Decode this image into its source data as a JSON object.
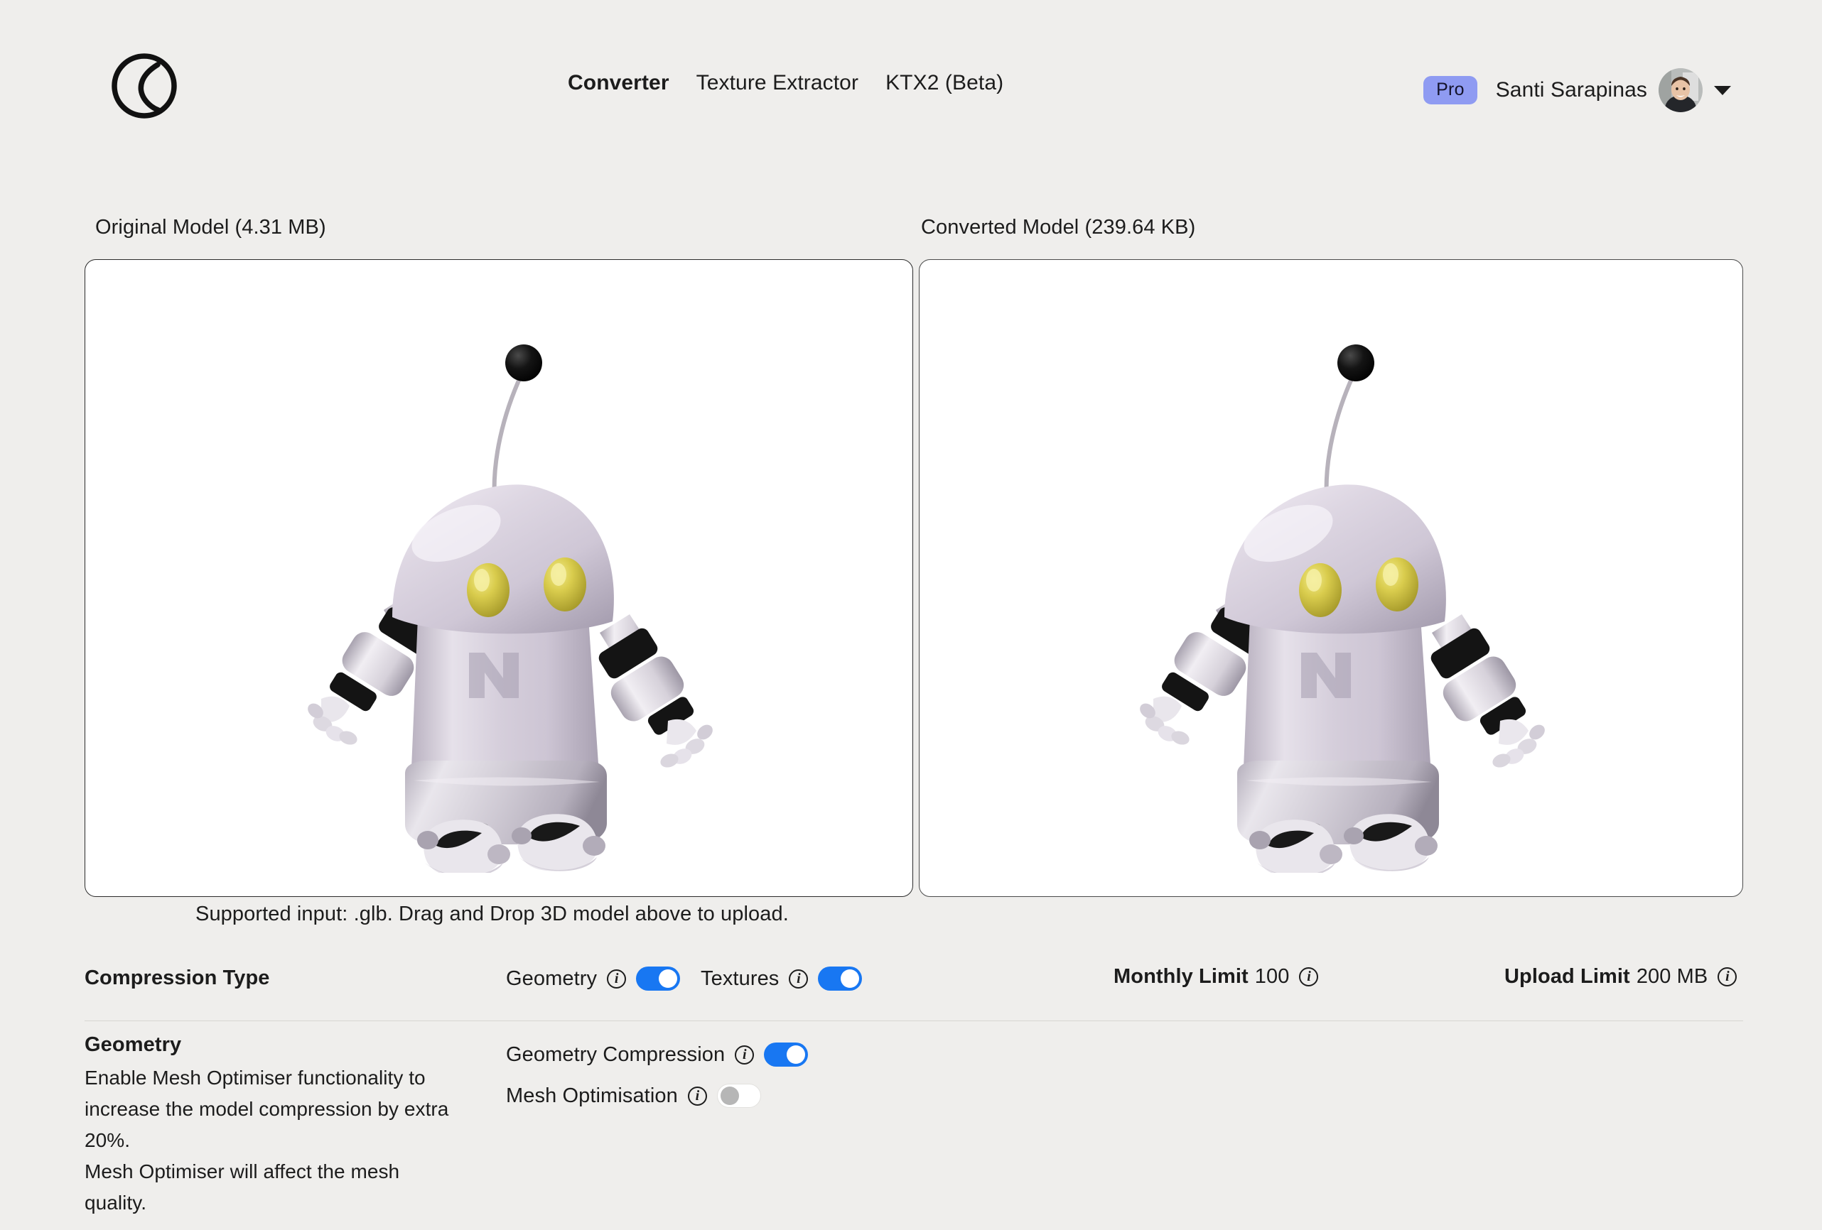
{
  "header": {
    "logo_icon": "crescent-circle-logo",
    "nav": [
      {
        "label": "Converter",
        "active": true
      },
      {
        "label": "Texture Extractor",
        "active": false
      },
      {
        "label": "KTX2 (Beta)",
        "active": false
      }
    ],
    "pro_badge": "Pro",
    "user_name": "Santi Sarapinas",
    "avatar_icon": "user-avatar-photo",
    "caret_icon": "chevron-down-icon"
  },
  "viewers": {
    "original_label": "Original Model (4.31 MB)",
    "converted_label": "Converted Model (239.64 KB)",
    "hint": "Supported input: .glb. Drag and Drop 3D model above to upload."
  },
  "compression": {
    "section_label": "Compression Type",
    "geometry_label": "Geometry",
    "geometry_on": true,
    "textures_label": "Textures",
    "textures_on": true,
    "monthly_limit_label": "Monthly Limit",
    "monthly_limit_value": "100",
    "upload_limit_label": "Upload Limit",
    "upload_limit_value": "200 MB",
    "info_icon": "info-icon"
  },
  "geometry_section": {
    "title": "Geometry",
    "description_line1": "Enable Mesh Optimiser functionality to increase the model compression by extra 20%.",
    "description_line2": "Mesh Optimiser will affect the mesh quality.",
    "geometry_compression_label": "Geometry Compression",
    "geometry_compression_on": true,
    "mesh_optimisation_label": "Mesh Optimisation",
    "mesh_optimisation_on": false
  },
  "colors": {
    "background": "#efeeec",
    "toggle_on": "#1877f2",
    "pro_badge": "#8f9bf2",
    "panel": "#ffffff",
    "text": "#1c1c1c",
    "robot_body": "#d8d2dc",
    "robot_eye": "#c8bb3c"
  }
}
